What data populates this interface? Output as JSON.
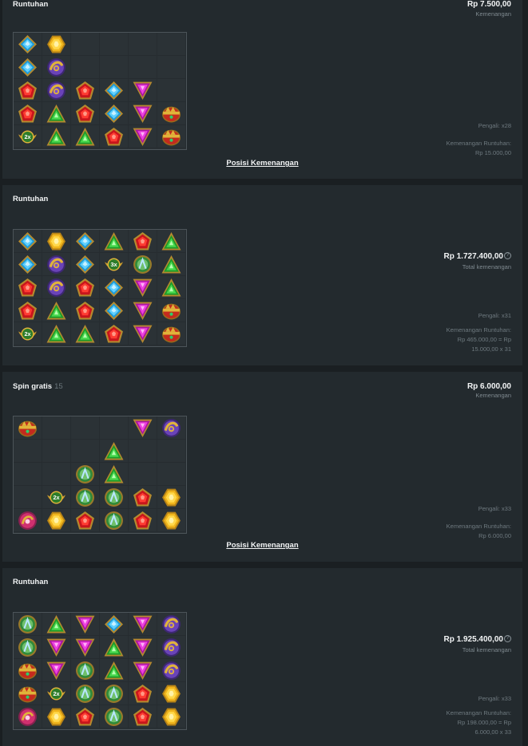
{
  "panels": [
    {
      "title": "Runtuhan",
      "subtitle": "",
      "amount": "Rp 7.500,00",
      "amount_label": "Kemenangan",
      "has_help": false,
      "multiplier": "Pengali: x28",
      "win_lines": [
        "Kemenangan Runtuhan:",
        "Rp 15.000,00"
      ],
      "link": "Posisi Kemenangan",
      "grid": [
        [
          "blue",
          "gold",
          "",
          "",
          "",
          ""
        ],
        [
          "blue",
          "ring",
          "",
          "",
          "",
          ""
        ],
        [
          "red",
          "ring",
          "red",
          "blue",
          "mag",
          ""
        ],
        [
          "red",
          "green",
          "red",
          "blue",
          "mag",
          "crown"
        ],
        [
          "wing2x",
          "green",
          "green",
          "red",
          "mag",
          "crown"
        ]
      ]
    },
    {
      "title": "Runtuhan",
      "subtitle": "",
      "amount": "Rp 1.727.400,00",
      "amount_label": "Total kemenangan",
      "has_help": true,
      "multiplier": "Pengali: x31",
      "win_lines": [
        "Kemenangan Runtuhan:",
        "Rp 465.000,00 = Rp",
        "15.000,00 x 31"
      ],
      "link": "",
      "grid": [
        [
          "blue",
          "gold",
          "blue",
          "green",
          "red",
          "green"
        ],
        [
          "blue",
          "ring",
          "blue",
          "wing3x",
          "orb",
          "green"
        ],
        [
          "red",
          "ring",
          "red",
          "blue",
          "mag",
          "green"
        ],
        [
          "red",
          "green",
          "red",
          "blue",
          "mag",
          "crown"
        ],
        [
          "wing2x",
          "green",
          "green",
          "red",
          "mag",
          "crown"
        ]
      ]
    },
    {
      "title": "Spin gratis",
      "subtitle": "15",
      "amount": "Rp 6.000,00",
      "amount_label": "Kemenangan",
      "has_help": false,
      "multiplier": "Pengali: x33",
      "win_lines": [
        "Kemenangan Runtuhan:",
        "Rp 6.000,00"
      ],
      "link": "Posisi Kemenangan",
      "grid": [
        [
          "crown",
          "",
          "",
          "",
          "mag",
          "ring"
        ],
        [
          "",
          "",
          "",
          "green",
          "",
          ""
        ],
        [
          "",
          "",
          "orb",
          "green",
          "",
          ""
        ],
        [
          "",
          "wing2x",
          "orb",
          "orb",
          "red",
          "gold"
        ],
        [
          "pink",
          "gold",
          "red",
          "orb",
          "red",
          "gold"
        ]
      ]
    },
    {
      "title": "Runtuhan",
      "subtitle": "",
      "amount": "Rp 1.925.400,00",
      "amount_label": "Total kemenangan",
      "has_help": true,
      "multiplier": "Pengali: x33",
      "win_lines": [
        "Kemenangan Runtuhan:",
        "Rp 198.000,00 = Rp",
        "6.000,00 x 33"
      ],
      "link": "",
      "grid": [
        [
          "orb",
          "green",
          "mag",
          "blue",
          "mag",
          "ring"
        ],
        [
          "orb",
          "mag",
          "mag",
          "green",
          "mag",
          "ring"
        ],
        [
          "crown",
          "mag",
          "orb",
          "green",
          "mag",
          "ring"
        ],
        [
          "crown",
          "wing2x",
          "orb",
          "orb",
          "red",
          "gold"
        ],
        [
          "pink",
          "gold",
          "red",
          "orb",
          "red",
          "gold"
        ]
      ]
    }
  ],
  "icons": {
    "blue": "blue-diamond-gem-icon",
    "gold": "gold-hexagon-gem-icon",
    "red": "red-pentagon-gem-icon",
    "green": "green-triangle-gem-icon",
    "mag": "magenta-inverted-triangle-gem-icon",
    "ring": "purple-ring-amulet-icon",
    "crown": "red-crown-pot-icon",
    "orb": "green-orb-icon",
    "pink": "pink-amulet-icon",
    "wing2x": "winged-multiplier-2x-icon",
    "wing3x": "winged-multiplier-3x-icon"
  },
  "multiplier_badges": {
    "wing2x": "2x",
    "wing3x": "3x"
  },
  "colors": {
    "page_bg": "#1a1f22",
    "panel_bg": "#232a2e",
    "grid_bg": "#2b3236"
  }
}
